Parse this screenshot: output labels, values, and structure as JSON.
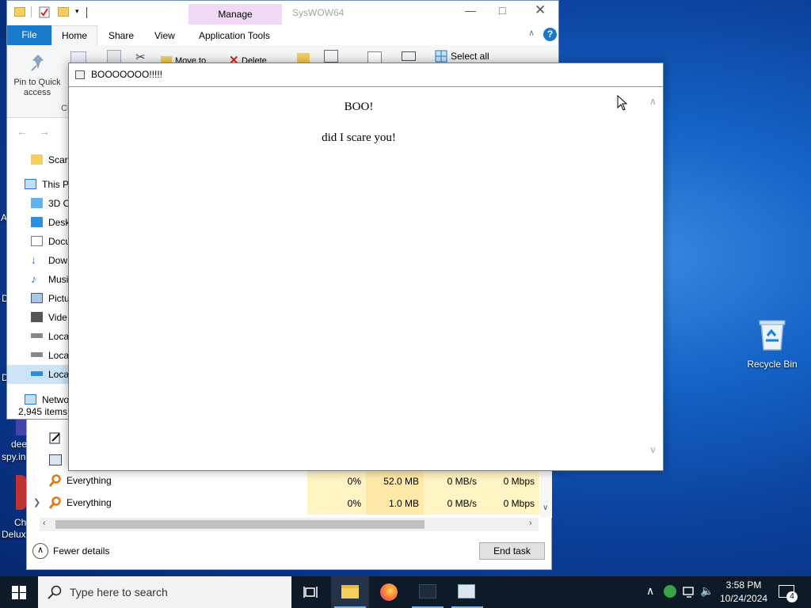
{
  "desktop": {
    "fragments": [
      "A",
      "D",
      "D",
      "dee",
      "spy.in",
      "Ch",
      "Delux"
    ],
    "recycle_bin_label": "Recycle Bin"
  },
  "explorer": {
    "title": "SysWOW64",
    "contextual_group": "Manage",
    "tabs": [
      "File",
      "Home",
      "Share",
      "View",
      "Application Tools"
    ],
    "ribbon": {
      "pin_label": "Pin to Quick access",
      "clip_fragment": "Cl",
      "move_to": "Move to",
      "delete": "Delete",
      "select_all": "Select all"
    },
    "nav": {
      "quick_folder": "Scary",
      "this_pc": "This P",
      "items": [
        "3D O",
        "Desk",
        "Docu",
        "Dow",
        "Musi",
        "Pictu",
        "Vide",
        "Loca",
        "Loca",
        "Loca"
      ],
      "network": "Netwo"
    },
    "status": "2,945 items"
  },
  "task_manager": {
    "rows": [
      {
        "name": "Everything",
        "cpu": "0%",
        "memory": "52.0 MB",
        "disk": "0 MB/s",
        "network": "0 Mbps"
      },
      {
        "name": "Everything",
        "cpu": "0%",
        "memory": "1.0 MB",
        "disk": "0 MB/s",
        "network": "0 Mbps"
      }
    ],
    "fewer_details": "Fewer details",
    "end_task": "End task"
  },
  "popup": {
    "title": "BOOOOOOO!!!!!",
    "heading": "BOO!",
    "message": "did I scare you!"
  },
  "taskbar": {
    "search_placeholder": "Type here to search",
    "time": "3:58 PM",
    "date": "10/24/2024",
    "notification_count": "4"
  },
  "colors": {
    "accent": "#0063b1",
    "manage_tab": "#f0d8f7",
    "taskbar": "#0f1a28",
    "highlight_cell": "#fff4c4"
  }
}
